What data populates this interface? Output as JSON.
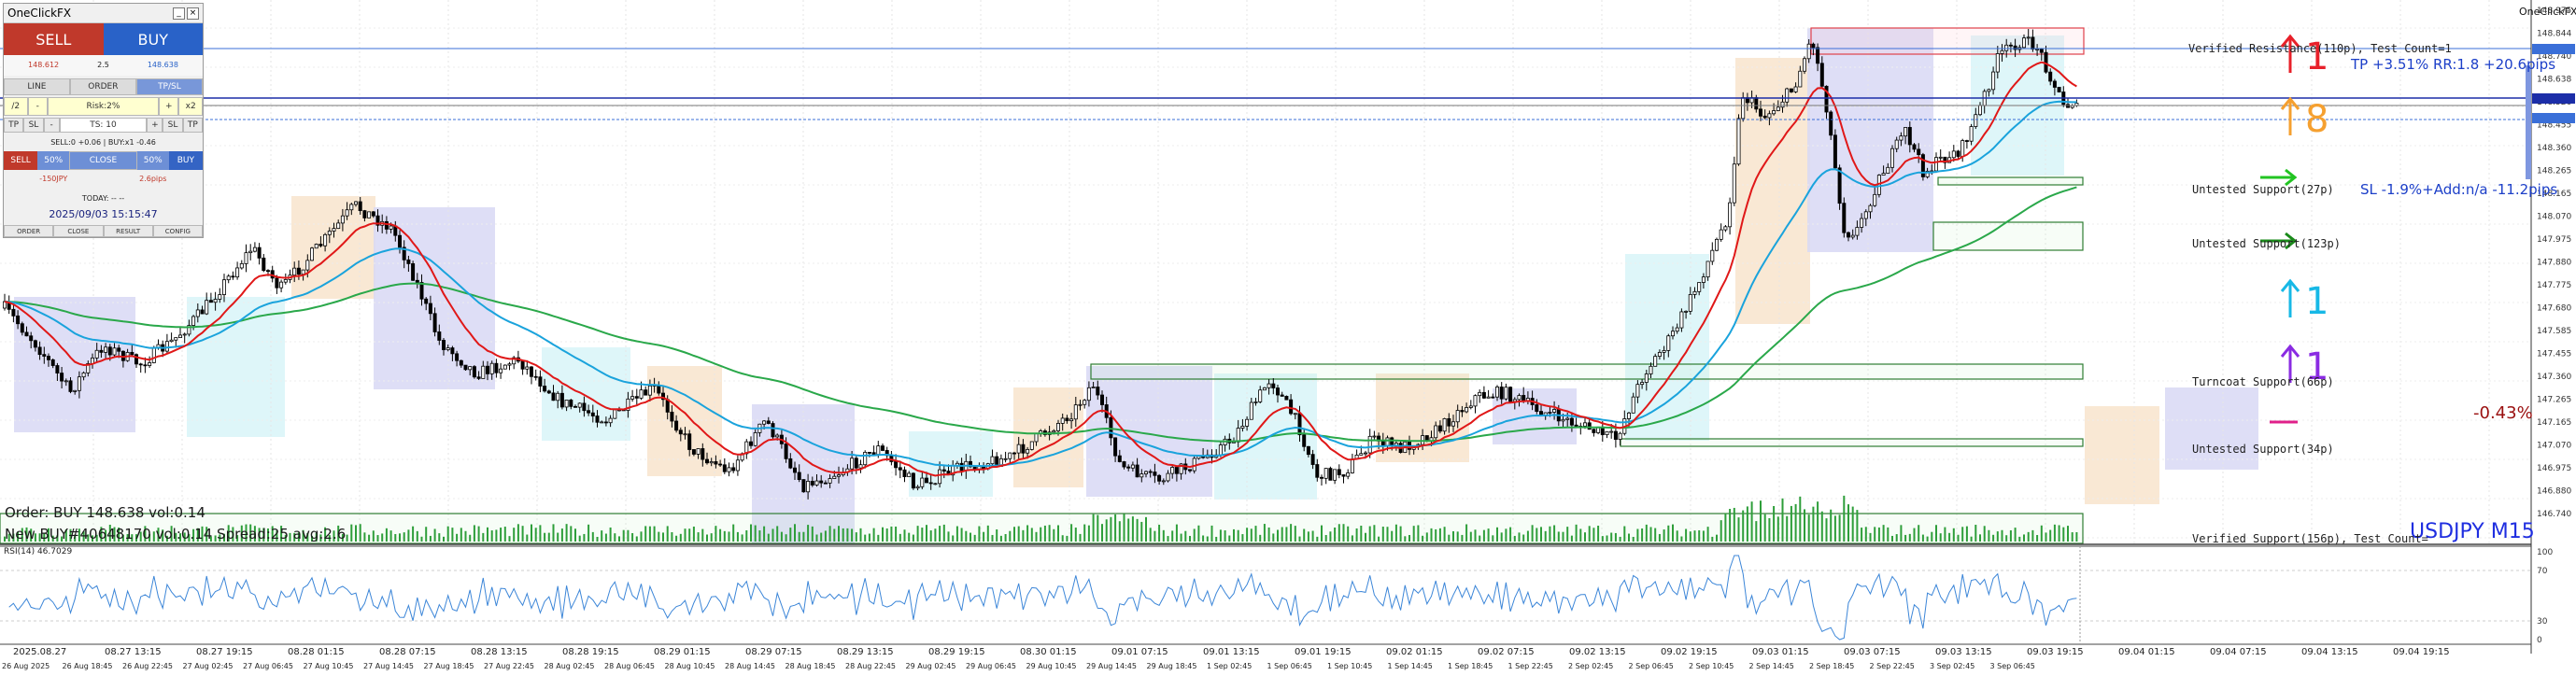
{
  "panel": {
    "title": "OneClickFX",
    "sell_label": "SELL",
    "buy_label": "BUY",
    "sell_price": "148.612",
    "buy_price": "148.638",
    "spread": "2.5",
    "tab_line": "LINE",
    "tab_order": "ORDER",
    "tab_tpsl": "TP/SL",
    "div2": "/2",
    "minus": "-",
    "risk": "Risk:2%",
    "plus": "+",
    "x2": "x2",
    "tp": "TP",
    "sl": "SL",
    "ts": "TS: 10",
    "sell_buy_info": "SELL:0 +0.06 | BUY:x1 -0.46",
    "sell_btn": "SELL",
    "pct50a": "50%",
    "close_btn": "CLOSE",
    "pct50b": "50%",
    "buy_btn": "BUY",
    "pnl_left": "-150JPY",
    "pnl_right": "2.6pips",
    "today": "TODAY: -- --",
    "datetime": "2025/09/03  15:15:47",
    "footer": [
      "ORDER",
      "CLOSE",
      "RESULT",
      "CONFIG"
    ]
  },
  "chart": {
    "symbol_tf": "USDJPY M15",
    "corner_label": "OneClickFX",
    "order_line1": "Order: BUY 148.638 vol:0.14",
    "order_line2": "New BUY#40648170 vol:0.14 Spread:25 avg:2.6",
    "rsi_label": "RSI(14) 46.7029",
    "tp_text": "TP +3.51% RR:1.8 +20.6pips",
    "sl_text": "SL -1.9%+Add:n/a -11.2pips",
    "pct_text": "-0.43%",
    "zones": [
      "Verified Resistance(110p), Test Count=1",
      "Untested Support(27p)",
      "Untested Support(123p)",
      "Turncoat Support(66p)",
      "Untested Support(34p)",
      "Verified Support(156p), Test Count="
    ],
    "signals": [
      {
        "dir": "up",
        "value": "1",
        "color": "#e8202a"
      },
      {
        "dir": "up",
        "value": "8",
        "color": "#f5a030"
      },
      {
        "dir": "right",
        "value": "",
        "color": "#22c422"
      },
      {
        "dir": "right",
        "value": "",
        "color": "#1a8a1a"
      },
      {
        "dir": "up",
        "value": "1",
        "color": "#17b8e6"
      },
      {
        "dir": "up",
        "value": "1",
        "color": "#8a2be2"
      },
      {
        "dir": "flat",
        "value": "",
        "color": "#e0208a"
      }
    ],
    "price_axis": [
      "148.975",
      "148.844",
      "148.740",
      "148.638",
      "148.526",
      "148.455",
      "148.360",
      "148.265",
      "148.165",
      "148.070",
      "147.975",
      "147.880",
      "147.775",
      "147.680",
      "147.585",
      "147.455",
      "147.360",
      "147.265",
      "147.165",
      "147.070",
      "146.975",
      "146.880",
      "146.740"
    ],
    "rsi_axis": [
      "100",
      "70",
      "30",
      "0"
    ],
    "time_top": [
      "2025.08.27",
      "08.27 13:15",
      "08.27 19:15",
      "08.28 01:15",
      "08.28 07:15",
      "08.28 13:15",
      "08.28 19:15",
      "08.29 01:15",
      "08.29 07:15",
      "08.29 13:15",
      "08.29 19:15",
      "08.30 01:15",
      "09.01 07:15",
      "09.01 13:15",
      "09.01 19:15",
      "09.02 01:15",
      "09.02 07:15",
      "09.02 13:15",
      "09.02 19:15",
      "09.03 01:15",
      "09.03 07:15",
      "09.03 13:15",
      "09.03 19:15",
      "09.04 01:15",
      "09.04 07:15",
      "09.04 13:15",
      "09.04 19:15"
    ],
    "time_bottom": [
      "26 Aug 2025",
      "26 Aug 18:45",
      "26 Aug 22:45",
      "27 Aug 02:45",
      "27 Aug 06:45",
      "27 Aug 10:45",
      "27 Aug 14:45",
      "27 Aug 18:45",
      "27 Aug 22:45",
      "28 Aug 02:45",
      "28 Aug 06:45",
      "28 Aug 10:45",
      "28 Aug 14:45",
      "28 Aug 18:45",
      "28 Aug 22:45",
      "29 Aug 02:45",
      "29 Aug 06:45",
      "29 Aug 10:45",
      "29 Aug 14:45",
      "29 Aug 18:45",
      "1 Sep 02:45",
      "1 Sep 06:45",
      "1 Sep 10:45",
      "1 Sep 14:45",
      "1 Sep 18:45",
      "1 Sep 22:45",
      "2 Sep 02:45",
      "2 Sep 06:45",
      "2 Sep 10:45",
      "2 Sep 14:45",
      "2 Sep 18:45",
      "2 Sep 22:45",
      "3 Sep 02:45",
      "3 Sep 06:45"
    ]
  }
}
